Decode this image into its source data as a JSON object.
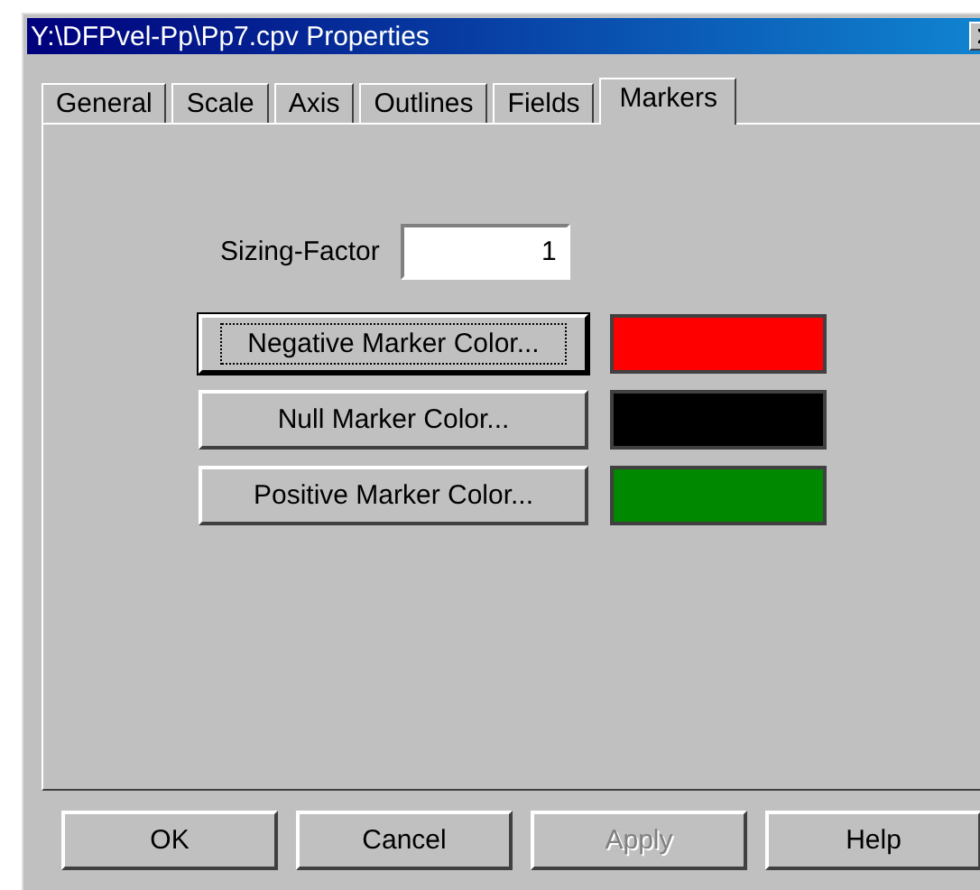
{
  "window": {
    "title": "Y:\\DFPvel-Pp\\Pp7.cpv Properties"
  },
  "tabs": [
    {
      "label": "General",
      "selected": false
    },
    {
      "label": "Scale",
      "selected": false
    },
    {
      "label": "Axis",
      "selected": false
    },
    {
      "label": "Outlines",
      "selected": false
    },
    {
      "label": "Fields",
      "selected": false
    },
    {
      "label": "Markers",
      "selected": true
    }
  ],
  "sizing_factor": {
    "label": "Sizing-Factor",
    "value": "1"
  },
  "markers": [
    {
      "label": "Negative Marker Color...",
      "focused": true,
      "color": "#ff0000"
    },
    {
      "label": "Null Marker Color...",
      "focused": false,
      "color": "#000000"
    },
    {
      "label": "Positive Marker Color...",
      "focused": false,
      "color": "#008800"
    }
  ],
  "buttons": [
    {
      "label": "OK",
      "disabled": false
    },
    {
      "label": "Cancel",
      "disabled": false
    },
    {
      "label": "Apply",
      "disabled": true
    },
    {
      "label": "Help",
      "disabled": false
    }
  ]
}
